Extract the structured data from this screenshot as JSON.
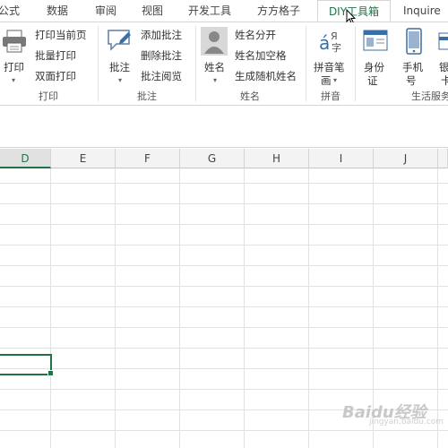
{
  "tabs": [
    {
      "label": "公式"
    },
    {
      "label": "数据"
    },
    {
      "label": "审阅"
    },
    {
      "label": "视图"
    },
    {
      "label": "开发工具"
    },
    {
      "label": "方方格子"
    },
    {
      "label": "DIY工具箱"
    },
    {
      "label": "Inquire"
    }
  ],
  "ribbon": {
    "print": {
      "big_label": "打印",
      "items": [
        "打印当前页",
        "批量打印",
        "双面打印"
      ],
      "group_label": "打印"
    },
    "comment": {
      "big_label": "批注",
      "items": [
        "添加批注",
        "删除批注",
        "批注阅览"
      ],
      "group_label": "批注"
    },
    "name": {
      "big_label": "姓名",
      "items": [
        "姓名分开",
        "姓名加空格",
        "生成随机姓名"
      ],
      "group_label": "姓名"
    },
    "pinyin": {
      "big_label_1": "拼音笔",
      "big_label_2": "画",
      "group_label": "拼音"
    },
    "life": {
      "id_label_1": "身份",
      "id_label_2": "证",
      "phone_label_1": "手机",
      "phone_label_2": "号",
      "bank_label_1": "银",
      "bank_label_2": "卡",
      "group_label": "生活服务"
    }
  },
  "columns": [
    "D",
    "E",
    "F",
    "G",
    "H",
    "I",
    "J"
  ],
  "active_column": "D",
  "watermark": {
    "main": "Baidu经验",
    "sub": "jingyan.baidu.com"
  },
  "colors": {
    "accent": "#217346",
    "grid": "#e1e1e1",
    "header_bg": "#f3f3f3"
  }
}
